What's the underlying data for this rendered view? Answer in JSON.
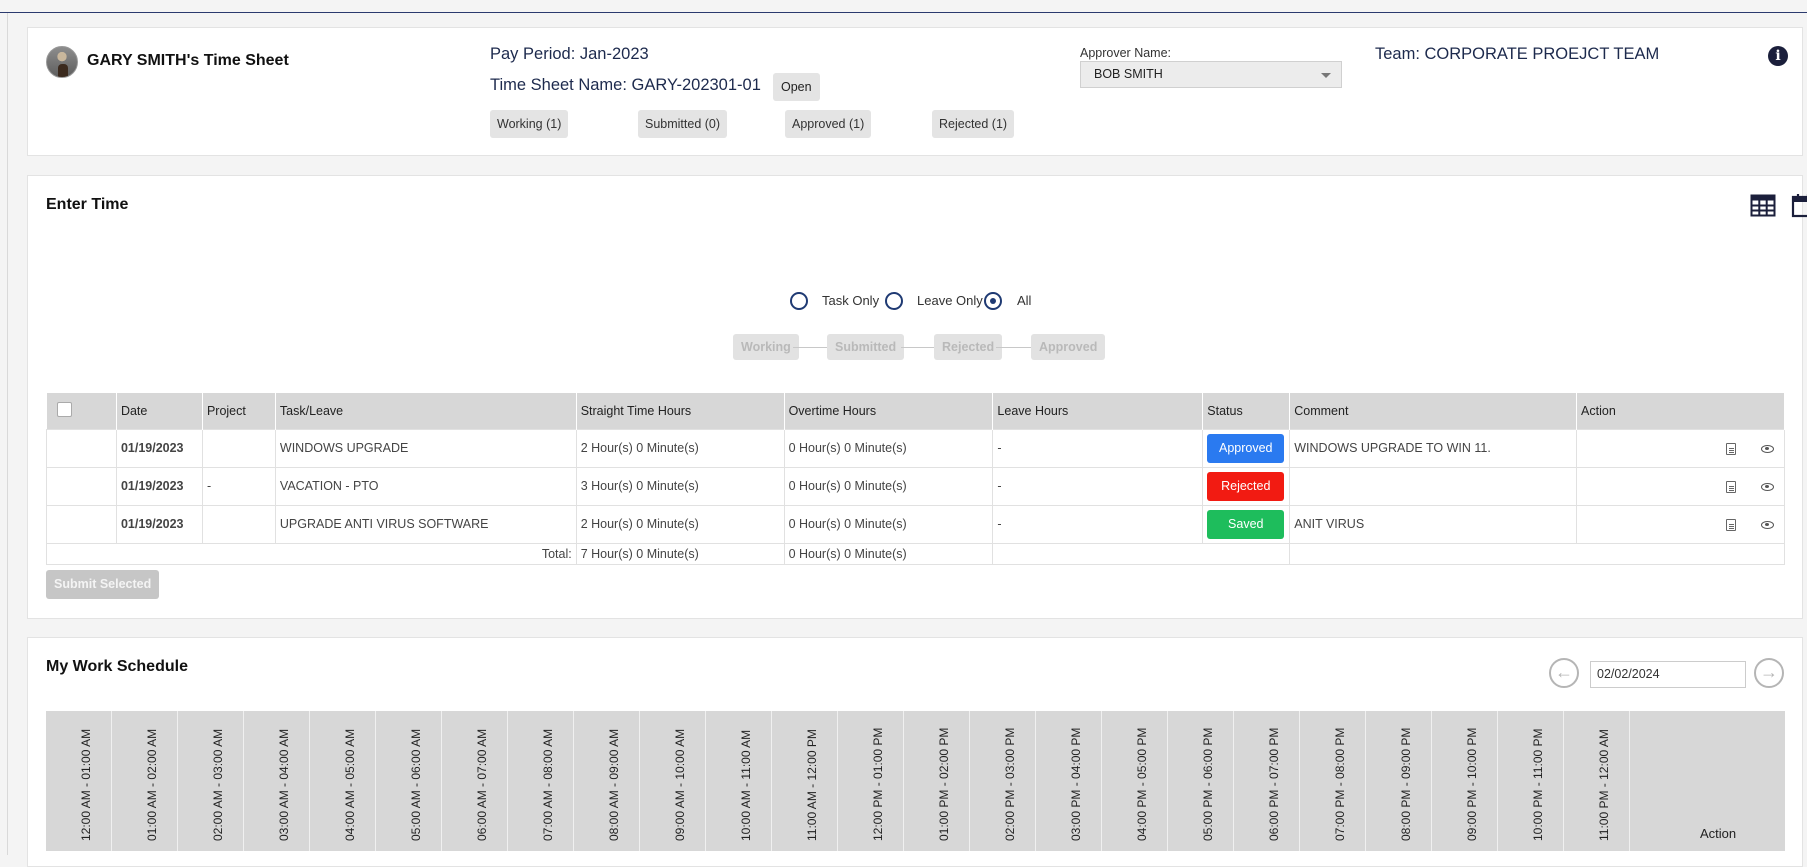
{
  "header": {
    "owner_title": "GARY SMITH's Time Sheet",
    "pay_period": "Pay Period: Jan-2023",
    "sheet_name": "Time Sheet Name: GARY-202301-01",
    "open_badge": "Open",
    "status_counts": [
      "Working (1)",
      "Submitted (0)",
      "Approved (1)",
      "Rejected (1)"
    ],
    "approver_label": "Approver Name:",
    "approver_value": "BOB SMITH",
    "team": "Team: CORPORATE PROEJCT TEAM"
  },
  "enter_time": {
    "title": "Enter Time",
    "filters": [
      {
        "label": "Task Only",
        "checked": false
      },
      {
        "label": "Leave Only",
        "checked": false
      },
      {
        "label": "All",
        "checked": true
      }
    ],
    "workflow": [
      "Working",
      "Submitted",
      "Rejected",
      "Approved"
    ],
    "columns": [
      "Date",
      "Project",
      "Task/Leave",
      "Straight Time Hours",
      "Overtime Hours",
      "Leave Hours",
      "Status",
      "Comment",
      "Action"
    ],
    "rows": [
      {
        "date": "01/19/2023",
        "project": "",
        "task": "WINDOWS UPGRADE",
        "straight": "2 Hour(s) 0 Minute(s)",
        "overtime": "0 Hour(s) 0 Minute(s)",
        "leave": "-",
        "status": "Approved",
        "comment": "WINDOWS UPGRADE TO WIN 11."
      },
      {
        "date": "01/19/2023",
        "project": "-",
        "task": "VACATION - PTO",
        "straight": "3 Hour(s) 0 Minute(s)",
        "overtime": "0 Hour(s) 0 Minute(s)",
        "leave": "-",
        "status": "Rejected",
        "comment": ""
      },
      {
        "date": "01/19/2023",
        "project": "",
        "task": "UPGRADE ANTI VIRUS SOFTWARE",
        "straight": "2 Hour(s) 0 Minute(s)",
        "overtime": "0 Hour(s) 0 Minute(s)",
        "leave": "-",
        "status": "Saved",
        "comment": "ANIT VIRUS"
      }
    ],
    "total_label": "Total:",
    "total_straight": "7 Hour(s) 0 Minute(s)",
    "total_overtime": "0 Hour(s) 0 Minute(s)",
    "submit_label": "Submit Selected"
  },
  "schedule": {
    "title": "My Work Schedule",
    "date_value": "02/02/2024",
    "hours": [
      "12:00 AM - 01:00 AM",
      "01:00 AM - 02:00 AM",
      "02:00 AM - 03:00 AM",
      "03:00 AM - 04:00 AM",
      "04:00 AM - 05:00 AM",
      "05:00 AM - 06:00 AM",
      "06:00 AM - 07:00 AM",
      "07:00 AM - 08:00 AM",
      "08:00 AM - 09:00 AM",
      "09:00 AM - 10:00 AM",
      "10:00 AM - 11:00 AM",
      "11:00 AM - 12:00 PM",
      "12:00 PM - 01:00 PM",
      "01:00 PM - 02:00 PM",
      "02:00 PM - 03:00 PM",
      "03:00 PM - 04:00 PM",
      "04:00 PM - 05:00 PM",
      "05:00 PM - 06:00 PM",
      "06:00 PM - 07:00 PM",
      "07:00 PM - 08:00 PM",
      "08:00 PM - 09:00 PM",
      "09:00 PM - 10:00 PM",
      "10:00 PM - 11:00 PM",
      "11:00 PM - 12:00 AM"
    ],
    "action_label": "Action"
  },
  "colors": {
    "approved": "#2a7af0",
    "rejected": "#f21b12",
    "saved": "#1ebd5c",
    "accent": "#1f3a73"
  }
}
